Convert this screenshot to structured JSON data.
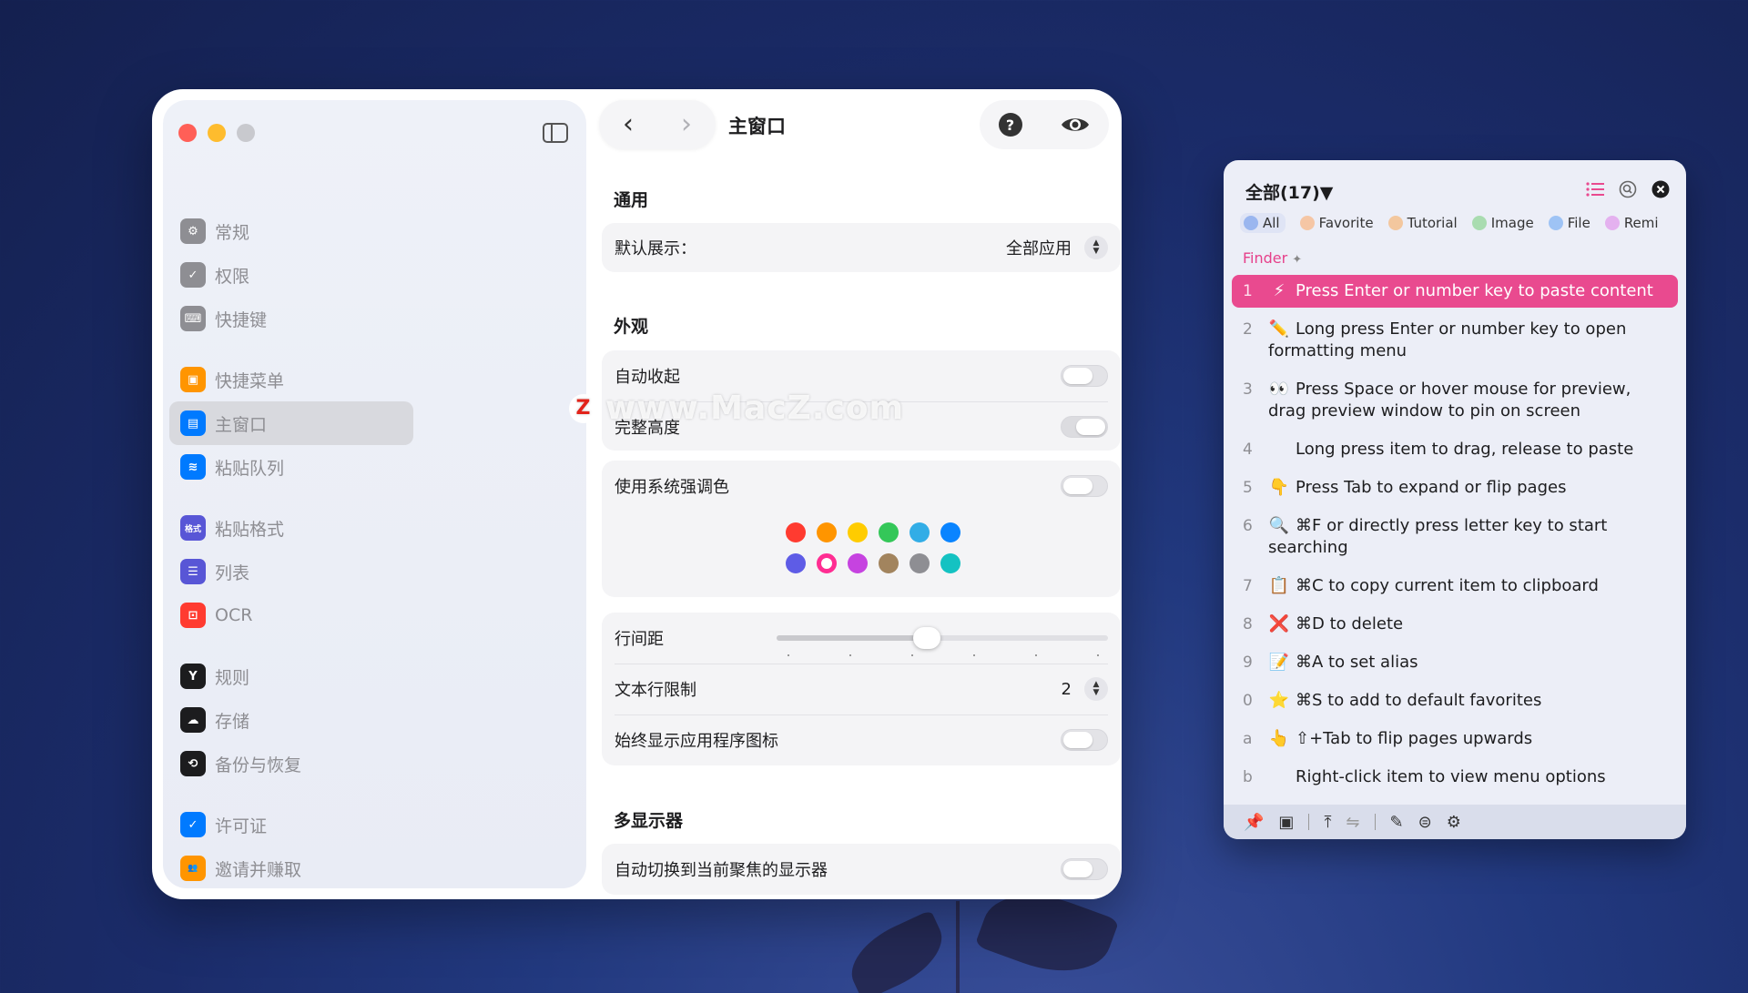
{
  "main_window": {
    "title": "主窗口",
    "sidebar": {
      "groups": [
        [
          {
            "label": "常规",
            "icon": "gear-icon",
            "color": "#8e8e93",
            "glyph": "⚙"
          },
          {
            "label": "权限",
            "icon": "shield-icon",
            "color": "#8e8e93",
            "glyph": "✓"
          },
          {
            "label": "快捷键",
            "icon": "keyboard-icon",
            "color": "#8e8e93",
            "glyph": "⌨"
          }
        ],
        [
          {
            "label": "快捷菜单",
            "icon": "menu-icon",
            "color": "#ff9500",
            "glyph": "▣"
          },
          {
            "label": "主窗口",
            "icon": "window-icon",
            "color": "#007aff",
            "glyph": "▤",
            "active": true
          },
          {
            "label": "粘贴队列",
            "icon": "stack-icon",
            "color": "#007aff",
            "glyph": "≋"
          }
        ],
        [
          {
            "label": "粘贴格式",
            "icon": "format-icon",
            "color": "#5856d6",
            "glyph": "格式"
          },
          {
            "label": "列表",
            "icon": "list-icon",
            "color": "#5856d6",
            "glyph": "☰"
          },
          {
            "label": "OCR",
            "icon": "ocr-icon",
            "color": "#ff3b30",
            "glyph": "⊡"
          }
        ],
        [
          {
            "label": "规则",
            "icon": "rule-icon",
            "color": "#1c1c1e",
            "glyph": "Y"
          },
          {
            "label": "存储",
            "icon": "cloud-icon",
            "color": "#1c1c1e",
            "glyph": "☁"
          },
          {
            "label": "备份与恢复",
            "icon": "restore-icon",
            "color": "#1c1c1e",
            "glyph": "⟲"
          }
        ],
        [
          {
            "label": "许可证",
            "icon": "license-icon",
            "color": "#007aff",
            "glyph": "✓"
          },
          {
            "label": "邀请并赚取",
            "icon": "invite-icon",
            "color": "#ff9500",
            "glyph": "👥"
          }
        ]
      ]
    },
    "sections": {
      "general": {
        "title": "通用",
        "default_display_label": "默认展示：",
        "default_display_value": "全部应用"
      },
      "appearance": {
        "title": "外观",
        "auto_collapse": "自动收起",
        "full_height": "完整高度",
        "system_accent": "使用系统强调色",
        "line_spacing": "行间距",
        "line_spacing_value": 0.45,
        "text_line_limit": "文本行限制",
        "text_line_limit_value": "2",
        "always_show_app_icon": "始终显示应用程序图标"
      },
      "multi_display": {
        "title": "多显示器",
        "auto_switch": "自动切换到当前聚焦的显示器"
      }
    },
    "accent_colors": {
      "row1": [
        "#ff3b30",
        "#ff9500",
        "#ffcc00",
        "#34c759",
        "#32ade6",
        "#0a84ff"
      ],
      "row2": [
        "#5e5ce6",
        "#ff2d92",
        "#c643e0",
        "#a2845e",
        "#8e8e93",
        "#14c2c2"
      ],
      "selected": "#ff2d92"
    }
  },
  "watermark": "www.MacZ.com",
  "watermark_logo": "Z",
  "panel": {
    "title": "全部(17)▼",
    "filters": [
      {
        "label": "All",
        "color": "#9ab6ef"
      },
      {
        "label": "Favorite",
        "color": "#f5c6a5"
      },
      {
        "label": "Tutorial",
        "color": "#f3c79e"
      },
      {
        "label": "Image",
        "color": "#a9dcb0"
      },
      {
        "label": "File",
        "color": "#9ec3f5"
      },
      {
        "label": "Remi",
        "color": "#e4b1ef"
      }
    ],
    "source": "Finder",
    "items": [
      {
        "num": "1",
        "emoji": "⚡",
        "text": "Press Enter or number key to paste content"
      },
      {
        "num": "2",
        "emoji": "✏️",
        "text": "Long press Enter or number key to open formatting menu"
      },
      {
        "num": "3",
        "emoji": "👀",
        "text": "Press Space or hover mouse for preview, drag preview window to pin on screen"
      },
      {
        "num": "4",
        "emoji": "",
        "text": "Long press item to drag, release to paste"
      },
      {
        "num": "5",
        "emoji": "👇",
        "text": "Press Tab to expand or flip pages"
      },
      {
        "num": "6",
        "emoji": "🔍",
        "text": "⌘F or directly press letter key to start searching"
      },
      {
        "num": "7",
        "emoji": "📋",
        "text": "⌘C to copy current item to clipboard"
      },
      {
        "num": "8",
        "emoji": "❌",
        "text": "⌘D to delete"
      },
      {
        "num": "9",
        "emoji": "📝",
        "text": "⌘A to set alias"
      },
      {
        "num": "0",
        "emoji": "⭐",
        "text": "⌘S to add to default favorites"
      },
      {
        "num": "a",
        "emoji": "👆",
        "text": "⇧+Tab to flip pages upwards"
      },
      {
        "num": "b",
        "emoji": "",
        "text": "Right-click item to view menu options"
      }
    ],
    "highlight_color": "#e94a8f"
  }
}
